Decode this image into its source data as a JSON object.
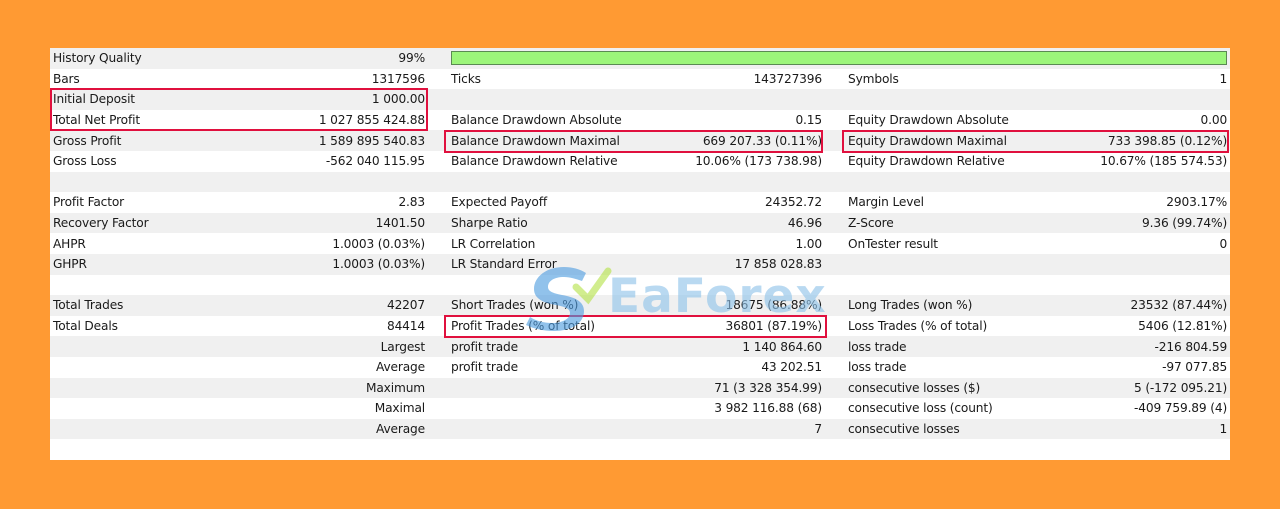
{
  "watermark": {
    "text": "EaForex"
  },
  "quality": {
    "label": "History Quality",
    "value": "99%",
    "bar_fill": 1.0
  },
  "rows": {
    "r2": {
      "a_label": "Bars",
      "a_value": "1317596",
      "b_label": "Ticks",
      "b_value": "143727396",
      "c_label": "Symbols",
      "c_value": "1"
    },
    "r3": {
      "a_label": "Initial Deposit",
      "a_value": "1 000.00",
      "b_label": "",
      "b_value": "",
      "c_label": "",
      "c_value": ""
    },
    "r4": {
      "a_label": "Total Net Profit",
      "a_value": "1 027 855 424.88",
      "b_label": "Balance Drawdown Absolute",
      "b_value": "0.15",
      "c_label": "Equity Drawdown Absolute",
      "c_value": "0.00"
    },
    "r5": {
      "a_label": "Gross Profit",
      "a_value": "1 589 895 540.83",
      "b_label": "Balance Drawdown Maximal",
      "b_value": "669 207.33 (0.11%)",
      "c_label": "Equity Drawdown Maximal",
      "c_value": "733 398.85 (0.12%)"
    },
    "r6": {
      "a_label": "Gross Loss",
      "a_value": "-562 040 115.95",
      "b_label": "Balance Drawdown Relative",
      "b_value": "10.06% (173 738.98)",
      "c_label": "Equity Drawdown Relative",
      "c_value": "10.67% (185 574.53)"
    },
    "r8": {
      "a_label": "Profit Factor",
      "a_value": "2.83",
      "b_label": "Expected Payoff",
      "b_value": "24352.72",
      "c_label": "Margin Level",
      "c_value": "2903.17%"
    },
    "r9": {
      "a_label": "Recovery Factor",
      "a_value": "1401.50",
      "b_label": "Sharpe Ratio",
      "b_value": "46.96",
      "c_label": "Z-Score",
      "c_value": "9.36 (99.74%)"
    },
    "r10": {
      "a_label": "AHPR",
      "a_value": "1.0003 (0.03%)",
      "b_label": "LR Correlation",
      "b_value": "1.00",
      "c_label": "OnTester result",
      "c_value": "0"
    },
    "r11": {
      "a_label": "GHPR",
      "a_value": "1.0003 (0.03%)",
      "b_label": "LR Standard Error",
      "b_value": "17 858 028.83",
      "c_label": "",
      "c_value": ""
    },
    "r13": {
      "a_label": "Total Trades",
      "a_value": "42207",
      "b_label": "Short Trades (won %)",
      "b_value": "18675 (86.88%)",
      "c_label": "Long Trades (won %)",
      "c_value": "23532 (87.44%)"
    },
    "r14": {
      "a_label": "Total Deals",
      "a_value": "84414",
      "b_label": "Profit Trades (% of total)",
      "b_value": "36801 (87.19%)",
      "c_label": "Loss Trades (% of total)",
      "c_value": "5406 (12.81%)"
    },
    "r15": {
      "a_label": "",
      "a_value": "Largest",
      "b_label": "profit trade",
      "b_value": "1 140 864.60",
      "c_label": "loss trade",
      "c_value": "-216 804.59"
    },
    "r16": {
      "a_label": "",
      "a_value": "Average",
      "b_label": "profit trade",
      "b_value": "43 202.51",
      "c_label": "loss trade",
      "c_value": "-97 077.85"
    },
    "r17": {
      "a_label": "",
      "a_value": "Maximum",
      "b_label": "",
      "b_value": "71 (3 328 354.99)",
      "c_label": "consecutive losses ($)",
      "c_value": "5 (-172 095.21)"
    },
    "r18": {
      "a_label": "",
      "a_value": "Maximal",
      "b_label": "",
      "b_value": "3 982 116.88 (68)",
      "c_label": "consecutive loss (count)",
      "c_value": "-409 759.89 (4)"
    },
    "r19": {
      "a_label": "",
      "a_value": "Average",
      "b_label": "",
      "b_value": "7",
      "c_label": "consecutive losses",
      "c_value": "1"
    }
  },
  "colors": {
    "background": "#ff9a33",
    "highlight": "#e0103e",
    "quality_bar": "#9cf57a",
    "watermark": "#8fc3ea"
  }
}
